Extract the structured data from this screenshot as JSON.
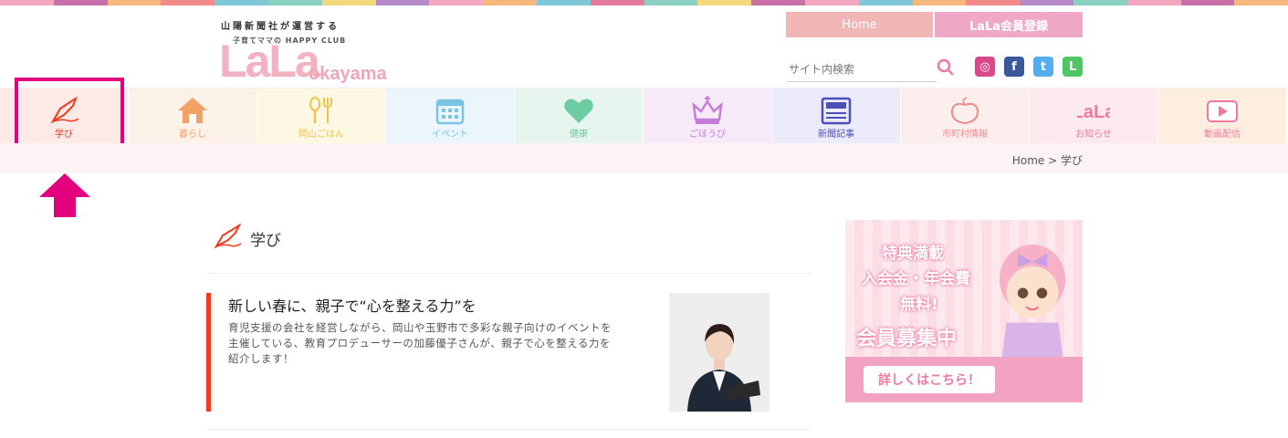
{
  "colors": {
    "stripe": [
      "#f5a7c0",
      "#c86fa8",
      "#f7b87d",
      "#f28a8a",
      "#7ec8d9",
      "#8ad1c2",
      "#f3d97a",
      "#b68ac9",
      "#f5a7c0",
      "#f7b87d",
      "#7ec8d9",
      "#e47b9d",
      "#8ad1c2",
      "#f3d97a",
      "#c86fa8",
      "#f5a7c0",
      "#7ec8d9",
      "#f7b87d",
      "#f28a8a",
      "#b68ac9",
      "#8ad1c2",
      "#f5a7c0",
      "#c86fa8",
      "#f7b87d"
    ],
    "highlight": "#e3007f",
    "accent": "#f03a1e"
  },
  "header": {
    "company": "山陽新聞社が運営する",
    "tagline": "子育てママの HAPPY CLUB",
    "logo_main": "LaLa",
    "logo_sub": "okayama",
    "nav_home": "Home",
    "nav_register": "LaLa会員登録",
    "search_placeholder": "サイト内検索"
  },
  "social": [
    {
      "name": "instagram-icon",
      "glyph": "◎",
      "color": "#d9488a"
    },
    {
      "name": "facebook-icon",
      "glyph": "f",
      "color": "#3b5998"
    },
    {
      "name": "twitter-icon",
      "glyph": "t",
      "color": "#55acee"
    },
    {
      "name": "line-icon",
      "glyph": "L",
      "color": "#4cc764"
    }
  ],
  "categories": [
    {
      "label": "学び",
      "bg": "#fde9e6",
      "color": "#f03a1e",
      "icon": "pen-icon"
    },
    {
      "label": "暮らし",
      "bg": "#fdf2e8",
      "color": "#f3a265",
      "icon": "house-icon"
    },
    {
      "label": "岡山ごはん",
      "bg": "#fdf8e4",
      "color": "#f0c24a",
      "icon": "spoon-fork-icon"
    },
    {
      "label": "イベント",
      "bg": "#eaf6fb",
      "color": "#79c3e4",
      "icon": "calendar-icon"
    },
    {
      "label": "健康",
      "bg": "#e7f5ef",
      "color": "#6dcba1",
      "icon": "heart-icon"
    },
    {
      "label": "ごほうび",
      "bg": "#f6eaf8",
      "color": "#c77bd9",
      "icon": "crown-icon"
    },
    {
      "label": "新聞記事",
      "bg": "#ebebfb",
      "color": "#4b4fb8",
      "icon": "newspaper-icon"
    },
    {
      "label": "市町村情報",
      "bg": "#fdeeee",
      "color": "#ef8a8a",
      "icon": "peach-icon"
    },
    {
      "label": "お知らせ",
      "bg": "#fde9ee",
      "color": "#ef7aa0",
      "icon": "lala-icon"
    },
    {
      "label": "動画配信",
      "bg": "#fdeedf",
      "color": "#ef7aa0",
      "icon": "video-icon"
    }
  ],
  "breadcrumb": "Home > 学び",
  "section_title": "学び",
  "article": {
    "title": "新しい春に、親子で“心を整える力”を",
    "description": "育児支援の会社を経営しながら、岡山や玉野市で多彩な親子向けのイベントを主催している、教育プロデューサーの加藤優子さんが、親子で心を整える力を紹介します！"
  },
  "banner": {
    "line1": "特典満載",
    "line2": "入会金・年会費",
    "line3": "無料!",
    "line4": "会員募集中",
    "button": "詳しくはこちら！"
  }
}
